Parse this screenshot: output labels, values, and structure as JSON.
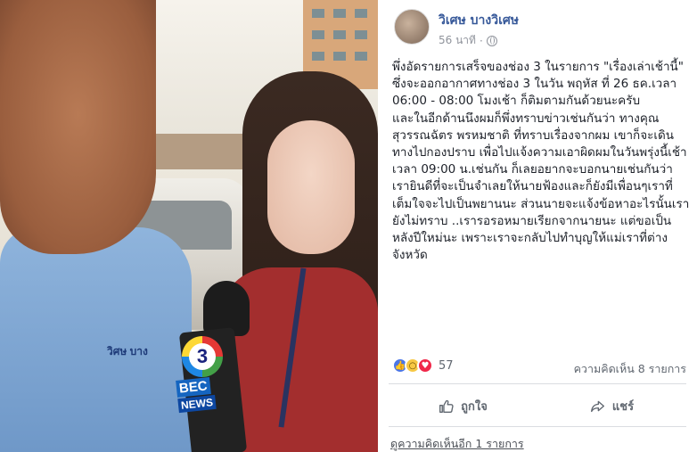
{
  "photo": {
    "shirt_text": "วิศษ บาง",
    "mic_logo_number": "3",
    "mic_logo_brand": "BEC",
    "mic_logo_sub": "NEWS"
  },
  "post": {
    "author": "วิเศษ บางวิเศษ",
    "time": "56 นาที",
    "separator": "·",
    "privacy_icon": "globe-icon",
    "paragraphs": [
      "พึ่งอัดรายการเสร็จของช่อง 3 ในรายการ \"เรื่องเล่าเช้านี้\" ซึ่งจะออกอากาศทางช่อง 3 ในวัน พฤหัส ที่ 26 ธค.เวลา 06:00 - 08:00 โมงเช้า ก็ติมตามกันด้วยนะครับ",
      "และในอีกด้านนึงผมก็พึ่งทราบข่าวเช่นกันว่า ทางคุณสุวรรณฉัตร พรหมชาติ ที่ทราบเรื่องจากผม เขาก็จะเดินทางไปกองปราบ เพื่อไปแจ้งความเอาผิดผมในวันพรุ่งนี้เช้าเวลา 09:00 น.เช่นกัน ก็เลยอยากจะบอกนายเช่นกันว่าเรายินดีที่จะเป็นจำเลยให้นายฟ้องและก็ยังมีเพื่อนๆเราที่เต็มใจจะไปเป็นพยานนะ ส่วนนายจะแจ้งข้อหาอะไรนั้นเรายังไม่ทราบ ..เรารอรอหมายเรียกจากนายนะ แต่ขอเป็นหลังปีใหม่นะ เพราะเราจะกลับไปทำบุญให้แม่เราที่ต่างจังหวัด"
    ],
    "reaction_count": "57",
    "comments_summary": "ความคิดเห็น 8 รายการ",
    "like_label": "ถูกใจ",
    "share_label": "แชร์",
    "more_comments": "ดูความคิดเห็นอีก 1 รายการ"
  },
  "colors": {
    "author_link": "#365899",
    "meta_gray": "#90949c",
    "like_blue": "#4a76e8",
    "love_red": "#f0284a",
    "wow_yellow": "#f7c844"
  }
}
